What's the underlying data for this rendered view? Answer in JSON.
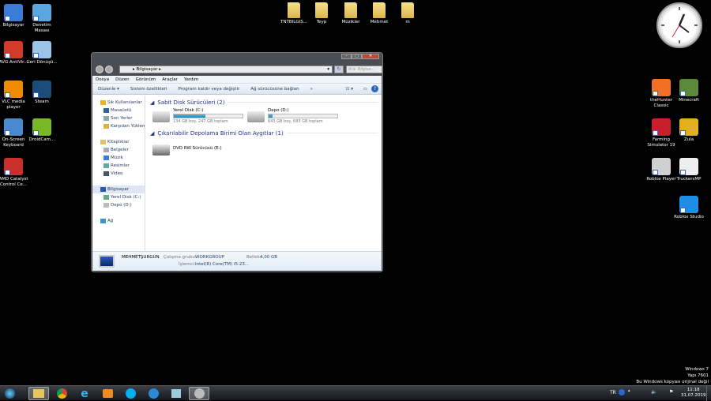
{
  "desktop": {
    "left_icons": [
      {
        "label": "Bilgisayar",
        "icon": "computer-icon",
        "color": "#3a7bd5"
      },
      {
        "label": "Denetim Masası",
        "icon": "control-panel-icon",
        "color": "#5aa7e0"
      },
      {
        "label": "AVG AntiVir...",
        "icon": "avg-icon",
        "color": "#d23a2a"
      },
      {
        "label": "Geri Dönüşü...",
        "icon": "recycle-bin-icon",
        "color": "#9bc4e6"
      },
      {
        "label": "VLC media player",
        "icon": "vlc-icon",
        "color": "#f08a00"
      },
      {
        "label": "Steam",
        "icon": "steam-icon",
        "color": "#1b4b78"
      },
      {
        "label": "On-Screen Keyboard",
        "icon": "keyboard-icon",
        "color": "#4a88d0"
      },
      {
        "label": "DroidCam...",
        "icon": "droidcam-icon",
        "color": "#79b829"
      },
      {
        "label": "AMD Catalyst Control Ce...",
        "icon": "amd-icon",
        "color": "#c9302c"
      }
    ],
    "right_icons": [
      {
        "label": "theHunter Classic",
        "icon": "thehunter-icon",
        "color": "#f07028"
      },
      {
        "label": "Minecraft",
        "icon": "minecraft-icon",
        "color": "#5c8a3a"
      },
      {
        "label": "Farming Simulator 19",
        "icon": "farming-simulator-icon",
        "color": "#c8202a"
      },
      {
        "label": "Zula",
        "icon": "zula-icon",
        "color": "#e3b020"
      },
      {
        "label": "Roblox Player",
        "icon": "roblox-icon",
        "color": "#d0d0d0"
      },
      {
        "label": "TruckersMP",
        "icon": "truckersmp-icon",
        "color": "#eeeeee"
      },
      {
        "label": "Roblox Studio",
        "icon": "roblox-studio-icon",
        "color": "#1e8ee6"
      }
    ],
    "folders": [
      "TNTBILGIS...",
      "Teyp",
      "Müzikler",
      "Mehmet",
      "m"
    ],
    "watermark": [
      "Windows 7",
      "Yapı 7601",
      "Bu Windows kopyası orijinal değil"
    ]
  },
  "window": {
    "address": "Bilgisayar",
    "search_placeholder": "Ara: Bilgisa...",
    "menu": [
      "Dosya",
      "Düzen",
      "Görünüm",
      "Araçlar",
      "Yardım"
    ],
    "toolbar": [
      "Düzenle ▾",
      "Sistem özellikleri",
      "Program kaldır veya değiştir",
      "Ağ sürücüsüne bağlan",
      "»"
    ],
    "nav": {
      "favorites": "Sık Kullanılanlar",
      "fav_items": [
        "Masaüstü",
        "Son Yerler",
        "Karşıdan Yüklem"
      ],
      "libraries": "Kitaplıklar",
      "lib_items": [
        "Belgeler",
        "Müzik",
        "Resimler",
        "Video"
      ],
      "computer": "Bilgisayar",
      "comp_items": [
        "Yerel Disk (C:)",
        "Depo (D:)"
      ],
      "network": "Ağ"
    },
    "groups": {
      "hdd": "Sabit Disk Sürücüleri (2)",
      "removable": "Çıkarılabilir Depolama Birimi Olan Aygıtlar (1)"
    },
    "drives": [
      {
        "name": "Yerel Disk (C:)",
        "info": "134 GB boş, 247 GB toplam",
        "used_percent": 46
      },
      {
        "name": "Depo (D:)",
        "info": "643 GB boş, 683 GB toplam",
        "used_percent": 6
      }
    ],
    "dvd": "DVD RW Sürücüsü (E:)",
    "details": {
      "name": "MEHMETŞURGUN",
      "workgroup_label": "Çalışma grubu:",
      "workgroup": "WORKGROUP",
      "memory_label": "Bellek:",
      "memory": "4,00 GB",
      "cpu_label": "İşlemci:",
      "cpu": "Intel(R) Core(TM) i5-23..."
    }
  },
  "taskbar": {
    "lang": "TR",
    "time": "11:18",
    "date": "31.07.2019"
  }
}
